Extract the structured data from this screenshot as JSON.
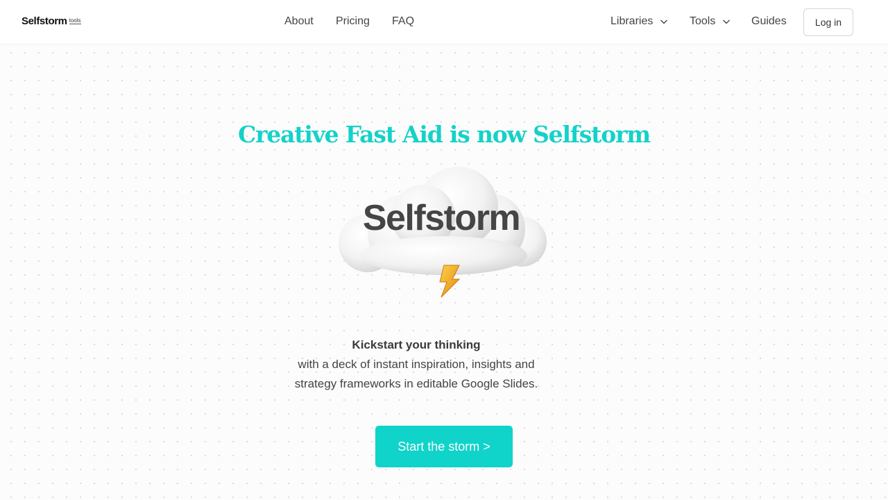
{
  "header": {
    "logo": {
      "name": "Selfstorm",
      "suffix": "tools"
    },
    "nav_center": [
      {
        "label": "About"
      },
      {
        "label": "Pricing"
      },
      {
        "label": "FAQ"
      }
    ],
    "nav_right": [
      {
        "label": "Libraries",
        "icon": "chevron-down-icon"
      },
      {
        "label": "Tools",
        "icon": "chevron-down-icon"
      },
      {
        "label": "Guides"
      }
    ],
    "login_label": "Log in"
  },
  "hero": {
    "headline": "Creative Fast Aid is now Selfstorm",
    "wordmark": "Selfstorm",
    "illustration_icons": [
      "cloud-icon",
      "lightning-bolt-icon"
    ],
    "tagline_bold": "Kickstart your thinking",
    "tagline_line1": "with a deck of instant inspiration, insights and",
    "tagline_line2": "strategy frameworks in editable Google Slides.",
    "cta_label": "Start the storm >"
  },
  "colors": {
    "accent": "#14d2c8",
    "cta_background": "#10d3ca",
    "text": "#444444",
    "bolt": "#f5b21a"
  }
}
